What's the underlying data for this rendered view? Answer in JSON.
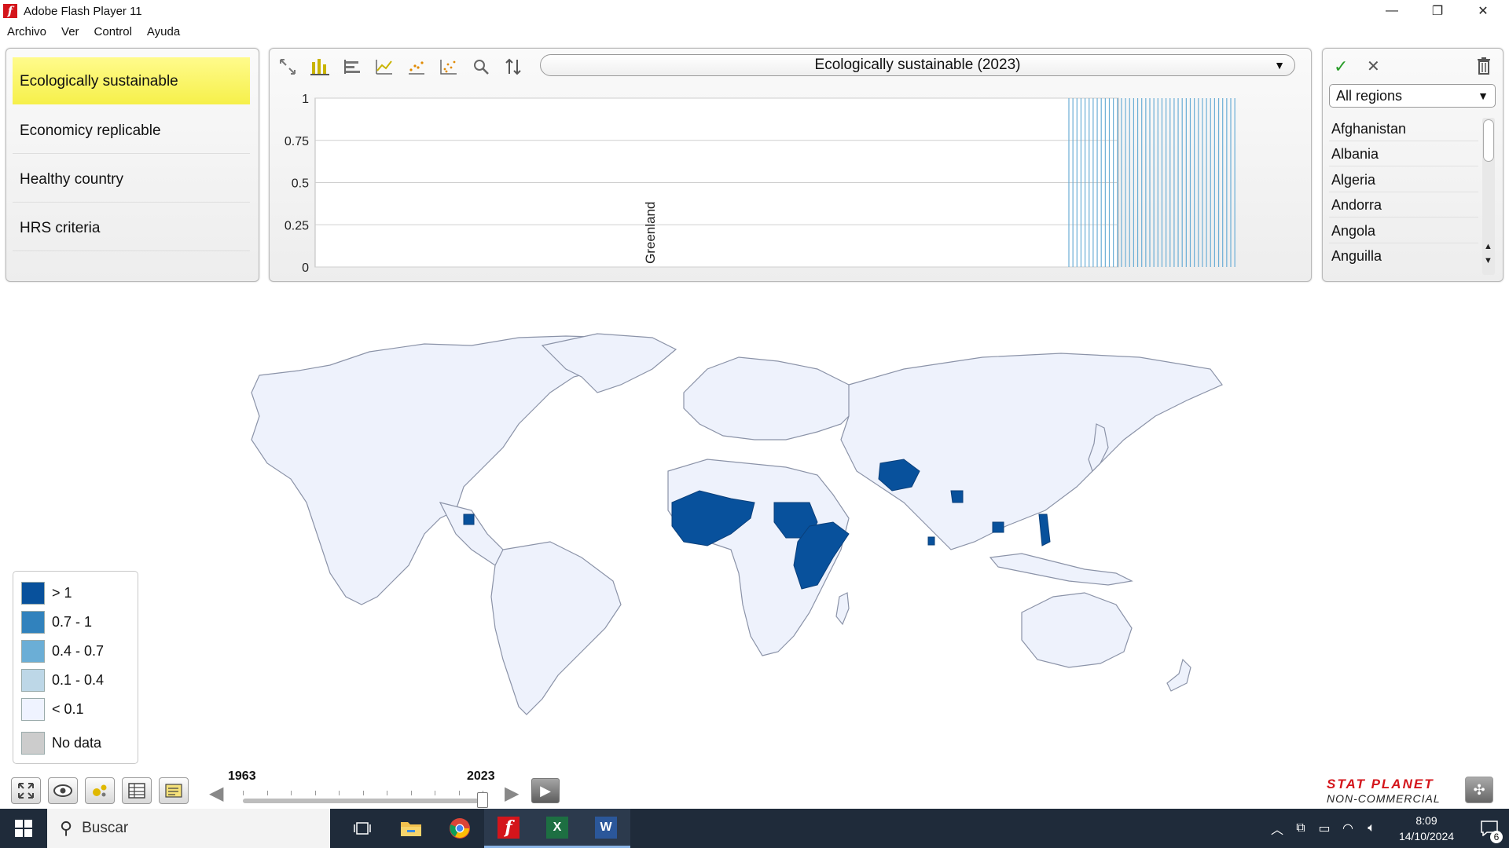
{
  "window": {
    "title": "Adobe Flash Player 11",
    "minimize": "—",
    "maximize": "❐",
    "close": "✕"
  },
  "menu": [
    "Archivo",
    "Ver",
    "Control",
    "Ayuda"
  ],
  "indicators": [
    {
      "label": "Ecologically sustainable",
      "selected": true
    },
    {
      "label": "Economicy replicable",
      "selected": false
    },
    {
      "label": "Healthy country",
      "selected": false
    },
    {
      "label": "HRS criteria",
      "selected": false
    }
  ],
  "chart_toolbar": {
    "icons": [
      "zoom-extent-icon",
      "bar-chart-icon",
      "horizontal-bar-icon",
      "line-chart-icon",
      "trend-dots-icon",
      "scatter-plot-icon",
      "search-icon",
      "sort-icon"
    ],
    "indicator_selected": "Ecologically sustainable (2023)"
  },
  "chart_data": {
    "type": "bar",
    "title": "",
    "ylim": [
      0,
      1
    ],
    "yticks": [
      "1",
      "0.75",
      "0.5",
      "0.25",
      "0"
    ],
    "labeled_category": "Greenland",
    "grid": true
  },
  "regions": {
    "selected": "All regions",
    "items": [
      "Afghanistan",
      "Albania",
      "Algeria",
      "Andorra",
      "Angola",
      "Anguilla"
    ]
  },
  "legend": {
    "items": [
      {
        "label": "> 1",
        "color": "#08519c"
      },
      {
        "label": "0.7 - 1",
        "color": "#3182bd"
      },
      {
        "label": "0.4 - 0.7",
        "color": "#6baed6"
      },
      {
        "label": "0.1 - 0.4",
        "color": "#bdd7e7"
      },
      {
        "label": "< 0.1",
        "color": "#eff3ff"
      },
      {
        "label": "No data",
        "color": "#cccccc"
      }
    ]
  },
  "timeline": {
    "start_year": "1963",
    "end_year": "2023",
    "progress": 1.0
  },
  "brand": {
    "line1": "STAT PLANET",
    "line2": "NON-COMMERCIAL"
  },
  "taskbar": {
    "search_placeholder": "Buscar",
    "time": "8:09",
    "date": "14/10/2024",
    "notifications": "6"
  },
  "colors": {
    "highlight": "#08519c",
    "land": "#eef2fc",
    "selected_indicator": "#f6f04a",
    "brand_red": "#d4151b"
  }
}
